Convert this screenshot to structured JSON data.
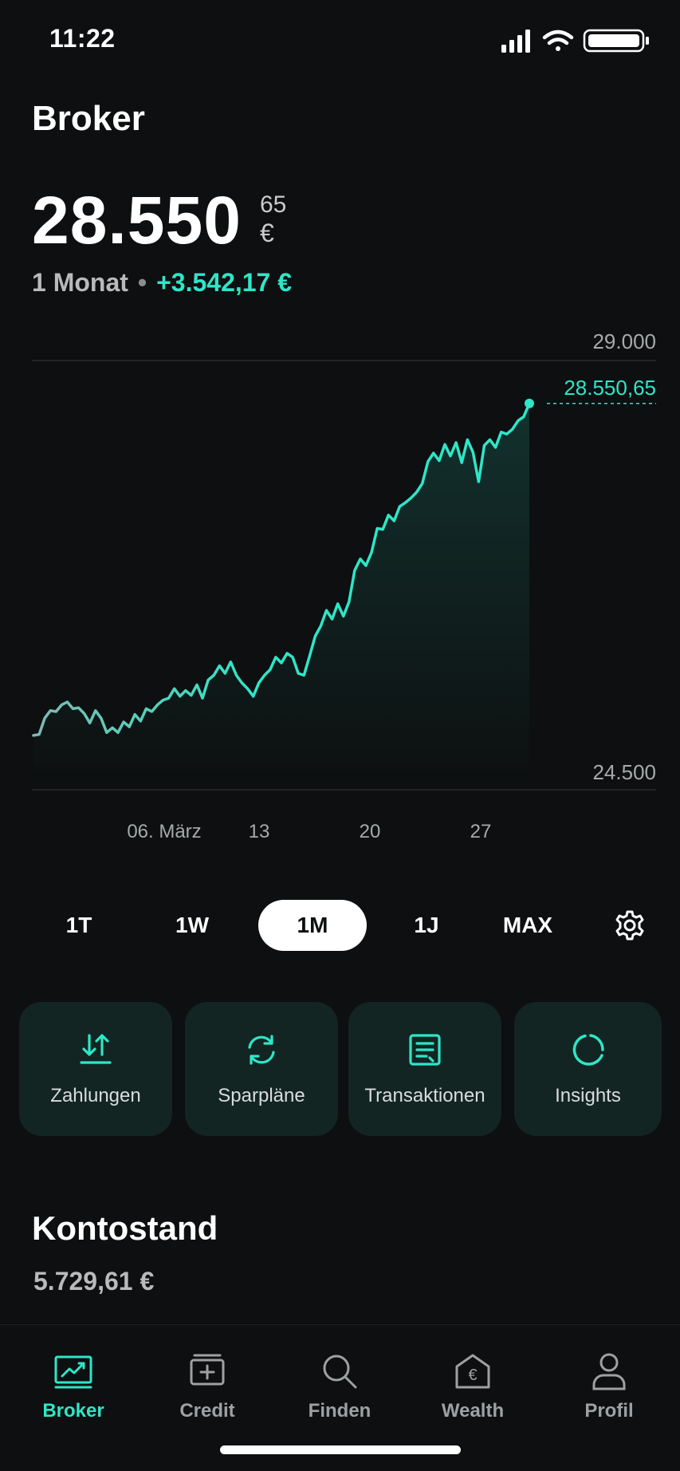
{
  "status_bar": {
    "time": "11:22"
  },
  "header": {
    "title": "Broker"
  },
  "balance": {
    "integer": "28.550",
    "cents": "65",
    "currency": "€"
  },
  "period": {
    "label": "1 Monat",
    "separator": "•",
    "change": "+3.542,17 €"
  },
  "chart_data": {
    "type": "line",
    "y_labels": {
      "top": "29.000",
      "bottom": "24.500"
    },
    "ylim": [
      24500,
      29000
    ],
    "current_value_label": "28.550,65",
    "current_value": 28550.65,
    "x_tick_labels": [
      "06. März",
      "13",
      "20",
      "27"
    ],
    "grid": "top and bottom reference lines",
    "series": [
      {
        "values": [
          25070,
          25080,
          25250,
          25330,
          25320,
          25390,
          25420,
          25350,
          25360,
          25300,
          25200,
          25330,
          25250,
          25100,
          25150,
          25100,
          25210,
          25160,
          25290,
          25220,
          25350,
          25320,
          25390,
          25440,
          25460,
          25560,
          25480,
          25540,
          25490,
          25600,
          25460,
          25650,
          25700,
          25800,
          25720,
          25840,
          25700,
          25620,
          25560,
          25480,
          25620,
          25700,
          25760,
          25890,
          25830,
          25930,
          25890,
          25720,
          25700,
          25900,
          26110,
          26220,
          26380,
          26290,
          26450,
          26320,
          26470,
          26800,
          26920,
          26850,
          26990,
          27240,
          27230,
          27380,
          27320,
          27470,
          27510,
          27560,
          27620,
          27710,
          27940,
          28030,
          27950,
          28120,
          28000,
          28140,
          27930,
          28170,
          28040,
          27730,
          28110,
          28170,
          28090,
          28250,
          28230,
          28280,
          28370,
          28410,
          28550
        ]
      }
    ]
  },
  "range_tabs": [
    {
      "label": "1T"
    },
    {
      "label": "1W"
    },
    {
      "label": "1M"
    },
    {
      "label": "1J"
    },
    {
      "label": "MAX"
    }
  ],
  "active_range": "1M",
  "actions": [
    {
      "label": "Zahlungen",
      "icon": "transfer-arrows-icon"
    },
    {
      "label": "Sparpläne",
      "icon": "refresh-icon"
    },
    {
      "label": "Transaktionen",
      "icon": "receipt-icon"
    },
    {
      "label": "Insights",
      "icon": "circle-progress-icon"
    }
  ],
  "kontostand": {
    "title": "Kontostand",
    "value": "5.729,61 €"
  },
  "tabbar": [
    {
      "label": "Broker",
      "icon": "chart-screen-icon"
    },
    {
      "label": "Credit",
      "icon": "credit-card-icon"
    },
    {
      "label": "Finden",
      "icon": "search-icon"
    },
    {
      "label": "Wealth",
      "icon": "euro-house-icon"
    },
    {
      "label": "Profil",
      "icon": "user-icon"
    }
  ],
  "colors": {
    "accent": "#2ee6c8",
    "background": "#0d0f10",
    "tile": "#122522"
  }
}
